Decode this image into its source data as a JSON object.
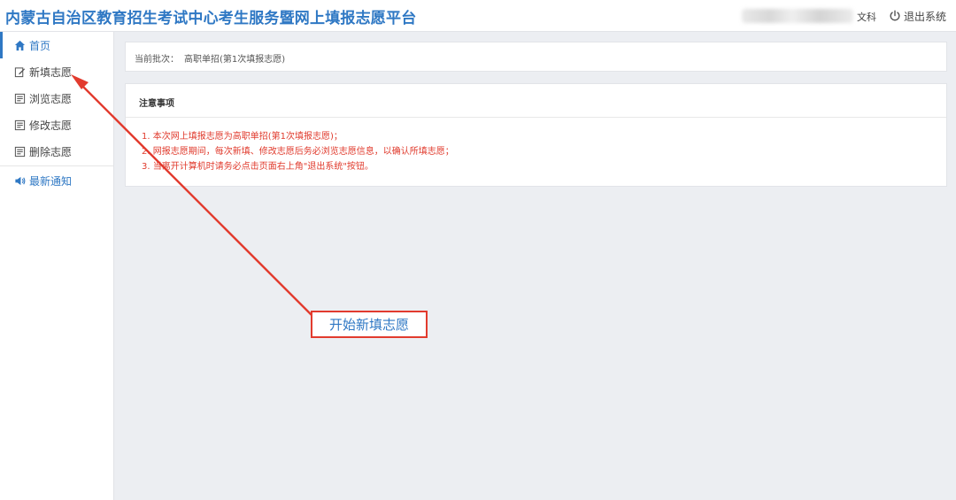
{
  "header": {
    "title": "内蒙古自治区教育招生考试中心考生服务暨网上填报志愿平台",
    "subject": "文科",
    "logout_label": "退出系统"
  },
  "sidebar": {
    "items": [
      {
        "label": "首页",
        "icon": "home-icon"
      },
      {
        "label": "新填志愿",
        "icon": "edit-icon"
      },
      {
        "label": "浏览志愿",
        "icon": "list-icon"
      },
      {
        "label": "修改志愿",
        "icon": "list-icon"
      },
      {
        "label": "删除志愿",
        "icon": "list-icon"
      },
      {
        "label": "最新通知",
        "icon": "speaker-icon"
      }
    ]
  },
  "main": {
    "batch_label": "当前批次：",
    "batch_value": "高职单招(第1次填报志愿)",
    "notice_title": "注意事项",
    "notices": [
      "1. 本次网上填报志愿为高职单招(第1次填报志愿)；",
      "2. 网报志愿期间，每次新填、修改志愿后务必浏览志愿信息，以确认所填志愿；",
      "3. 当离开计算机时请务必点击页面右上角\"退出系统\"按钮。"
    ]
  },
  "annotation": {
    "label": "开始新填志愿"
  },
  "colors": {
    "brand_blue": "#2f78c4",
    "notice_red": "#e03a2c",
    "annotation_red": "#e23b2e",
    "background": "#eceef2"
  }
}
